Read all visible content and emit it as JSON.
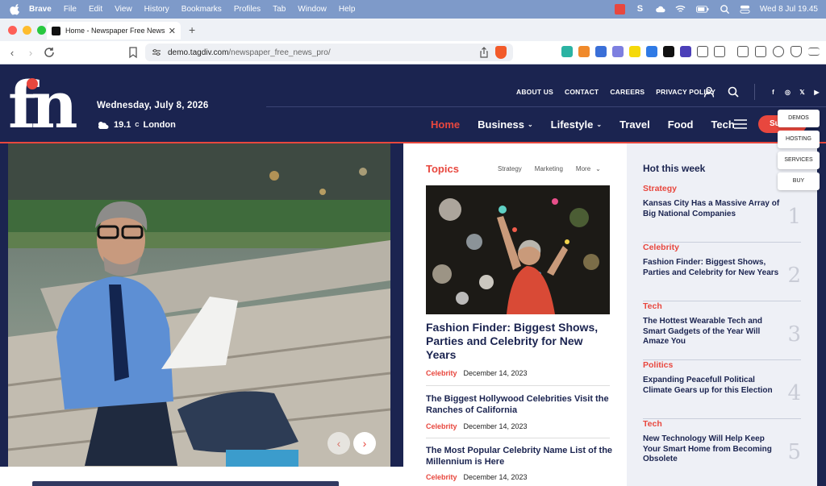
{
  "menubar": {
    "app": "Brave",
    "items": [
      "File",
      "Edit",
      "View",
      "History",
      "Bookmarks",
      "Profiles",
      "Tab",
      "Window",
      "Help"
    ],
    "clock": "Wed 8 Jul  19.45"
  },
  "browser": {
    "tab_title": "Home - Newspaper Free News",
    "url_host": "demo.tagdiv.com",
    "url_path": "/newspaper_free_news_pro/"
  },
  "header": {
    "logo_text": "fn",
    "date": "Wednesday, July 8, 2026",
    "weather_temp": "19.1",
    "weather_unit": "C",
    "weather_city": "London",
    "top_links": [
      "ABOUT US",
      "CONTACT",
      "CAREERS",
      "PRIVACY POLICY"
    ],
    "social": [
      "f",
      "◎",
      "𝕏",
      "▶"
    ],
    "main_nav": [
      {
        "label": "Home",
        "active": true,
        "dropdown": false
      },
      {
        "label": "Business",
        "active": false,
        "dropdown": true
      },
      {
        "label": "Lifestyle",
        "active": false,
        "dropdown": true
      },
      {
        "label": "Travel",
        "active": false,
        "dropdown": false
      },
      {
        "label": "Food",
        "active": false,
        "dropdown": false
      },
      {
        "label": "Tech",
        "active": false,
        "dropdown": false
      }
    ],
    "subscribe_label": "Su"
  },
  "side_menu": [
    "DEMOS",
    "HOSTING",
    "SERVICES",
    "BUY"
  ],
  "topics": {
    "heading": "Topics",
    "tabs": [
      "Strategy",
      "Marketing",
      "More"
    ],
    "lead": {
      "title": "Fashion Finder: Biggest Shows, Parties and Celebrity for New Years",
      "category": "Celebrity",
      "date": "December 14, 2023"
    },
    "articles": [
      {
        "title": "The Biggest Hollywood Celebrities Visit the Ranches of California",
        "category": "Celebrity",
        "date": "December 14, 2023"
      },
      {
        "title": "The Most Popular Celebrity Name List of the Millennium is Here",
        "category": "Celebrity",
        "date": "December 14, 2023"
      }
    ]
  },
  "hot": {
    "heading": "Hot this week",
    "items": [
      {
        "category": "Strategy",
        "title": "Kansas City Has a Massive Array of Big National Companies",
        "num": "1"
      },
      {
        "category": "Celebrity",
        "title": "Fashion Finder: Biggest Shows, Parties and Celebrity for New Years",
        "num": "2"
      },
      {
        "category": "Tech",
        "title": "The Hottest Wearable Tech and Smart Gadgets of the Year Will Amaze You",
        "num": "3"
      },
      {
        "category": "Politics",
        "title": "Expanding Peacefull Political Climate Gears up for this Election",
        "num": "4"
      },
      {
        "category": "Tech",
        "title": "New Technology Will Help Keep Your Smart Home from Becoming Obsolete",
        "num": "5"
      }
    ]
  },
  "colors": {
    "navy": "#1b2450",
    "accent": "#e8473e",
    "menubar": "#7e9ac9"
  }
}
